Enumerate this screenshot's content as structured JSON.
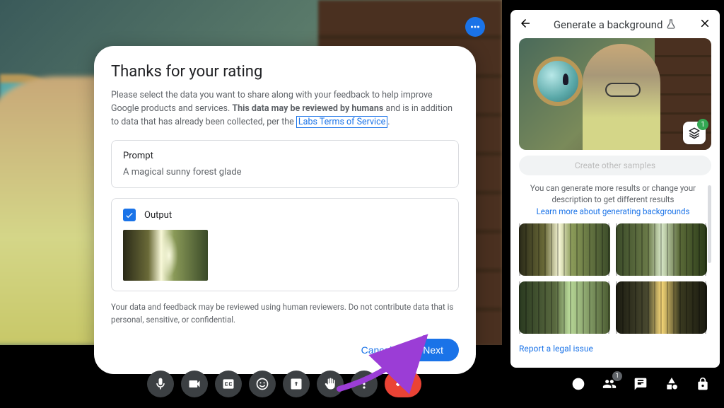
{
  "modal": {
    "title": "Thanks for your rating",
    "desc_part1": "Please select the data you want to share along with your feedback to help improve Google products and services. ",
    "desc_bold": "This data may be reviewed by humans",
    "desc_part2": " and is in addition to data that has already been collected, per the ",
    "tos_link": "Labs Terms of Service",
    "prompt_label": "Prompt",
    "prompt_text": "A magical sunny forest glade",
    "output_label": "Output",
    "disclaimer": "Your data and feedback may be reviewed using human reviewers. Do not contribute data that is personal, sensitive, or confidential.",
    "cancel": "Cancel",
    "next": "Next"
  },
  "panel": {
    "title": "Generate a background",
    "layers_count": "1",
    "create_button": "Create other samples",
    "gen_info": "You can generate more results or change your description to get different results",
    "gen_link": "Learn more about generating backgrounds",
    "report": "Report a legal issue"
  },
  "bottom": {
    "people_count": "1"
  }
}
